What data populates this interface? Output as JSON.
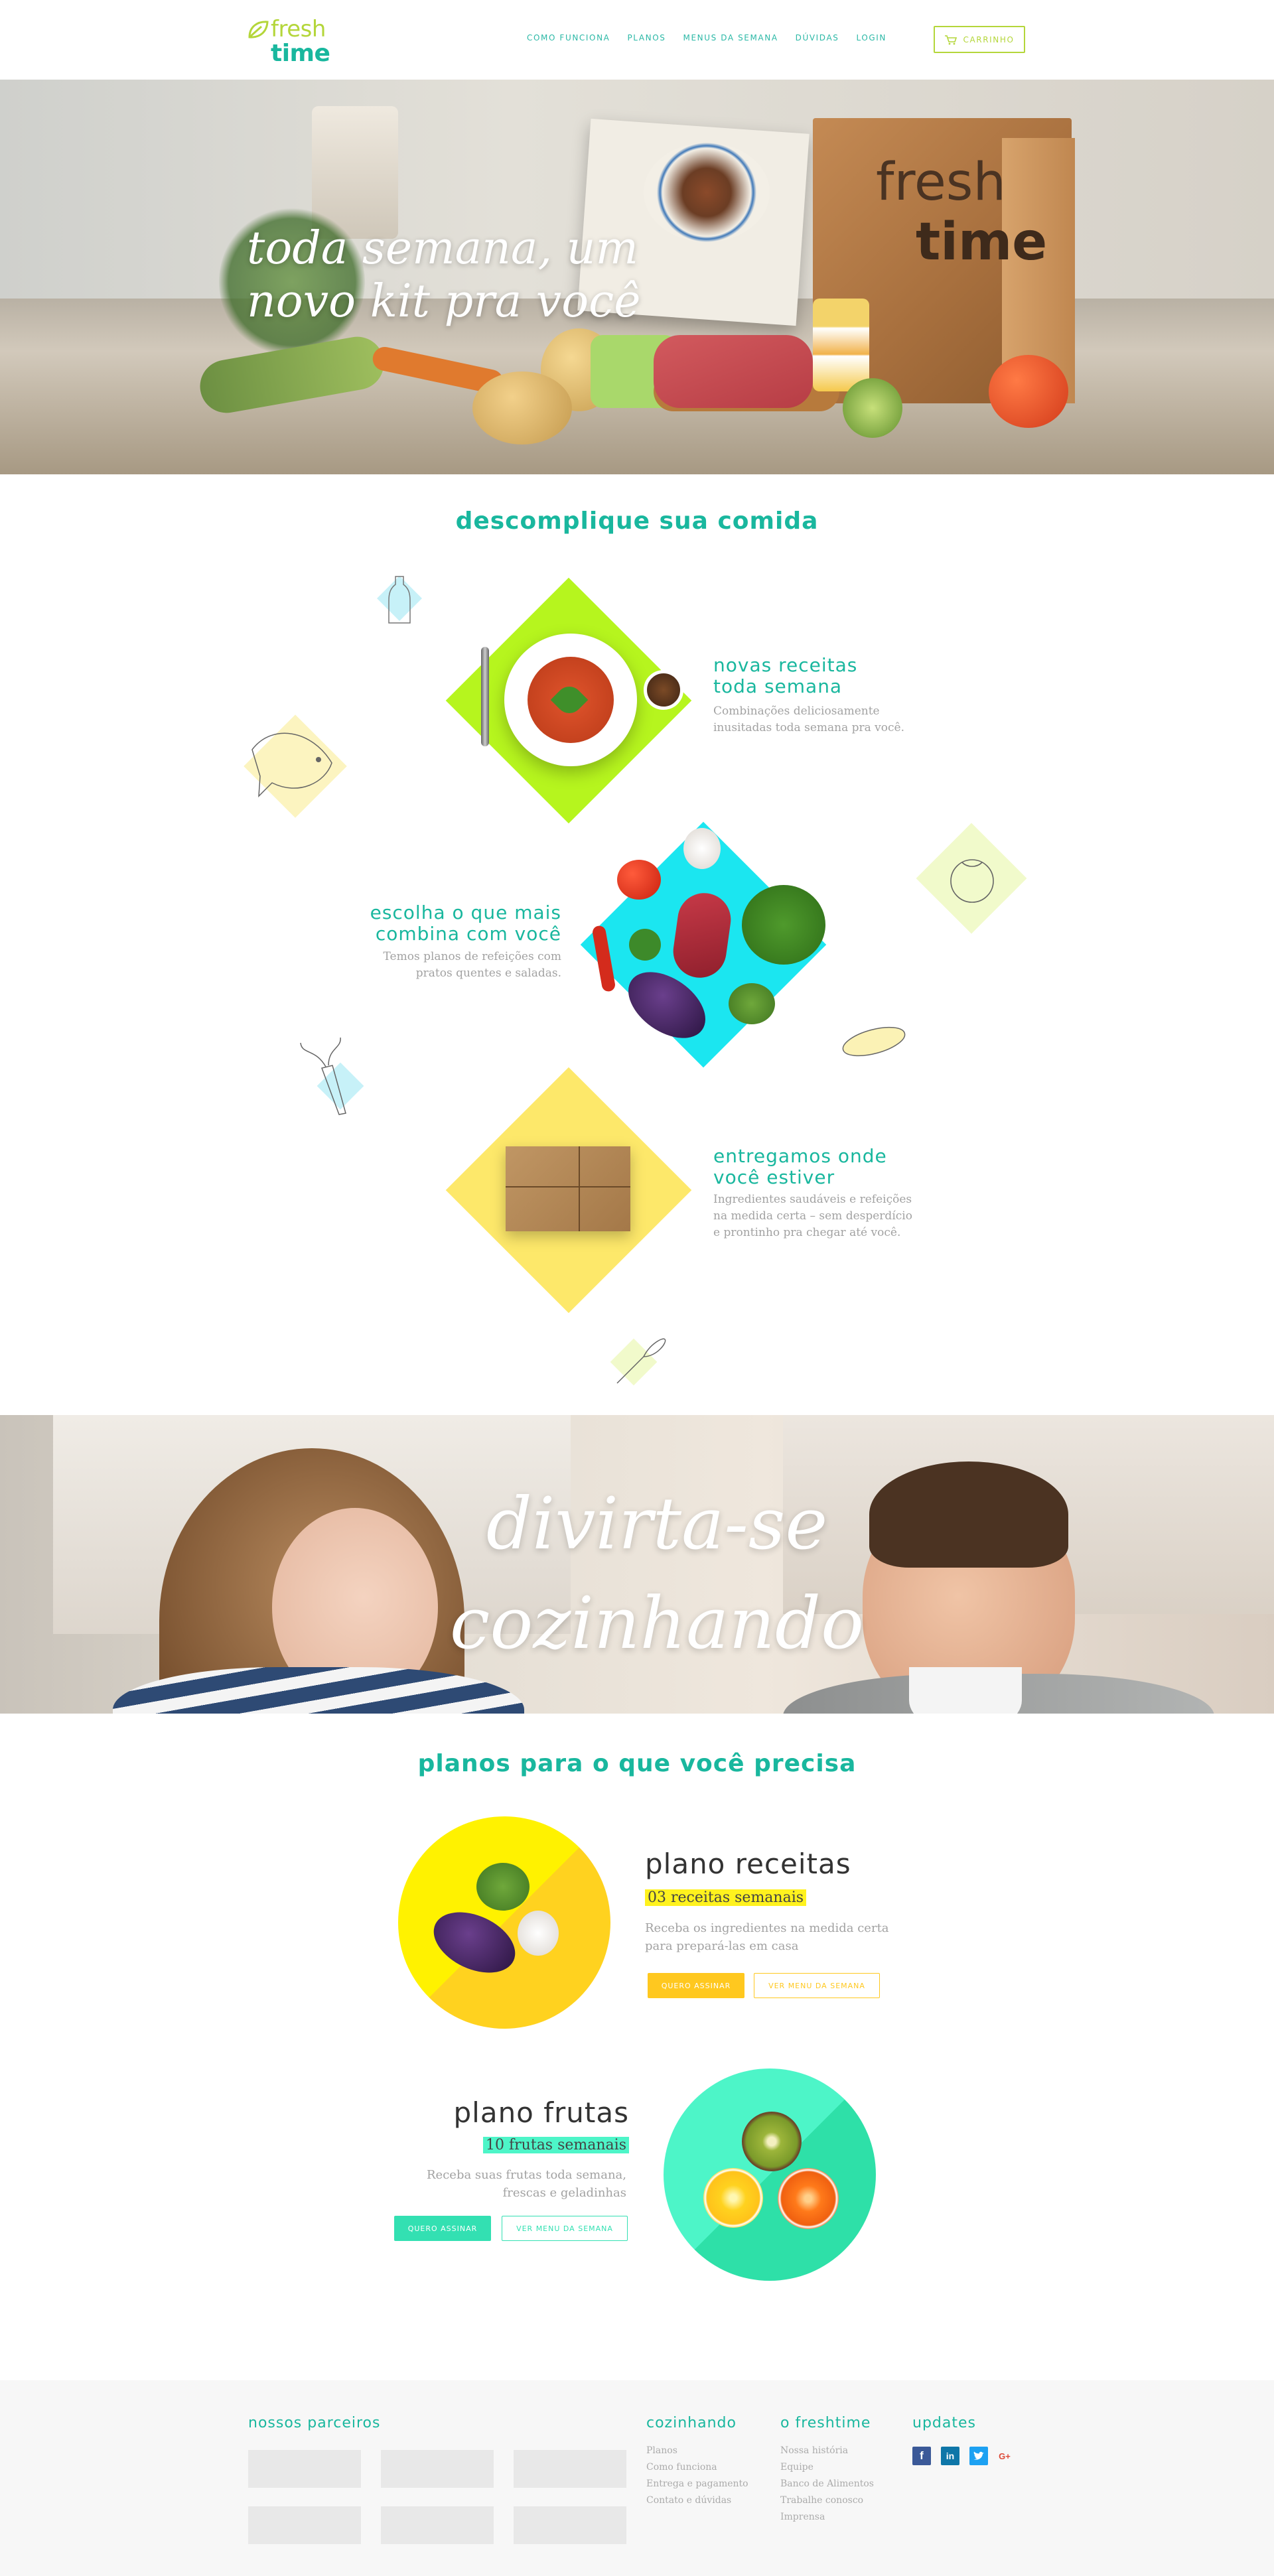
{
  "colors": {
    "brand_green": "#19b79e",
    "brand_lime": "#b4d63a",
    "yellow": "#ffd21f",
    "mint": "#3ff0c4"
  },
  "header": {
    "logo_fresh": "fresh",
    "logo_time": "time",
    "nav": [
      "COMO FUNCIONA",
      "PLANOS",
      "MENUS DA SEMANA",
      "DÚVIDAS",
      "LOGIN"
    ],
    "cart_label": "CARRINHO",
    "cart_icon": "cart-icon"
  },
  "hero": {
    "headline_line1": "toda semana, um",
    "headline_line2": "novo kit pra você",
    "box_word1": "fresh",
    "box_word2": "time"
  },
  "features": {
    "title": "descomplique sua comida",
    "items": [
      {
        "title_line1": "novas receitas",
        "title_line2": "toda semana",
        "desc_line1": "Combinações deliciosamente",
        "desc_line2": "inusitadas toda semana pra você."
      },
      {
        "title_line1": "escolha o que mais",
        "title_line2": "combina com você",
        "desc_line1": "Temos planos de refeições com",
        "desc_line2": "pratos quentes e saladas."
      },
      {
        "title_line1": "entregamos onde",
        "title_line2": "você estiver",
        "desc_line1": "Ingredientes saudáveis e refeições",
        "desc_line2": "na medida certa – sem desperdício",
        "desc_line3": "e prontinho pra chegar até você."
      }
    ]
  },
  "banner": {
    "line1": "divirta-se",
    "line2": "cozinhando"
  },
  "plans": {
    "title": "planos para o que você precisa",
    "items": [
      {
        "name": "plano receitas",
        "badge": "03 receitas semanais",
        "desc_line1": "Receba os ingredientes na medida certa",
        "desc_line2": "para prepará-las em casa",
        "primary": "QUERO ASSINAR",
        "secondary": "VER MENU DA SEMANA"
      },
      {
        "name": "plano frutas",
        "badge": "10 frutas semanais",
        "desc_line1": "Receba suas frutas toda semana,",
        "desc_line2": "frescas e geladinhas",
        "primary": "QUERO ASSINAR",
        "secondary": "VER MENU DA SEMANA"
      }
    ]
  },
  "footer": {
    "partners_heading": "nossos parceiros",
    "cozinhando": {
      "heading": "cozinhando",
      "links": [
        "Planos",
        "Como funciona",
        "Entrega e pagamento",
        "Contato e dúvidas"
      ]
    },
    "freshtime": {
      "heading": "o freshtime",
      "links": [
        "Nossa história",
        "Equipe",
        "Banco de Alimentos",
        "Trabalhe conosco",
        "Imprensa"
      ]
    },
    "updates": {
      "heading": "updates",
      "icons": [
        "facebook-icon",
        "linkedin-icon",
        "twitter-icon",
        "google-plus-icon"
      ]
    }
  }
}
